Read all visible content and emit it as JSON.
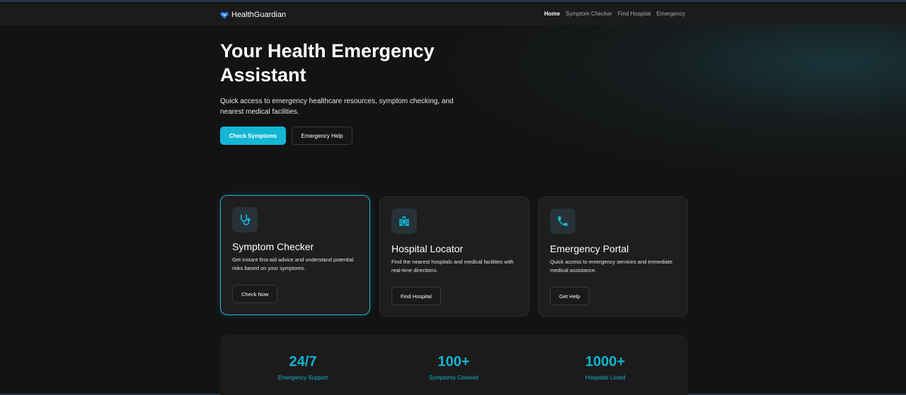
{
  "nav": {
    "brand": "HealthGuardian",
    "brand_icon": "heart-icon",
    "links": [
      "Home",
      "Symptom Checker",
      "Find Hospital",
      "Emergency"
    ],
    "active": "Home"
  },
  "hero": {
    "title": "Your Health Emergency Assistant",
    "subtitle": "Quick access to emergency healthcare resources, symptom checking, and nearest medical facilities.",
    "primary_button": "Check Symptoms",
    "secondary_button": "Emergency Help"
  },
  "cards": [
    {
      "icon": "stethoscope-icon",
      "title": "Symptom Checker",
      "description": "Get instant first-aid advice and understand potential risks based on your symptoms.",
      "button": "Check Now",
      "highlighted": true
    },
    {
      "icon": "hospital-icon",
      "title": "Hospital Locator",
      "description": "Find the nearest hospitals and medical facilities with real-time directions.",
      "button": "Find Hospital",
      "highlighted": false
    },
    {
      "icon": "phone-icon",
      "title": "Emergency Portal",
      "description": "Quick access to emergency services and immediate medical assistance.",
      "button": "Get Help",
      "highlighted": false
    }
  ],
  "stats": [
    {
      "value": "24/7",
      "label": "Emergency Support"
    },
    {
      "value": "100+",
      "label": "Symptoms Covered"
    },
    {
      "value": "1000+",
      "label": "Hospitals Listed"
    }
  ],
  "colors": {
    "accent": "#13b7d4",
    "background": "#131313",
    "card": "#1e1e1e",
    "brand_heart": "#2f7bf0"
  }
}
